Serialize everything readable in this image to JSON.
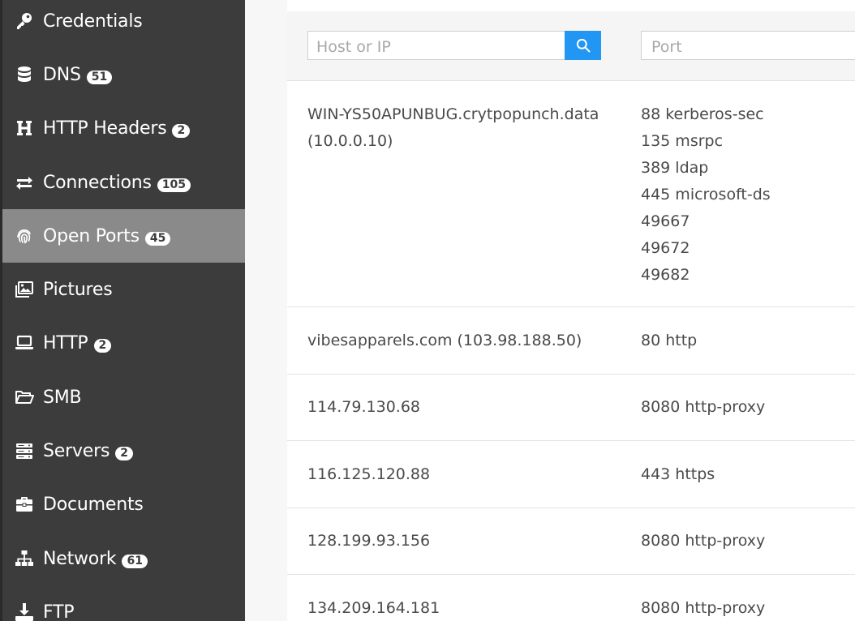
{
  "sidebar": {
    "items": [
      {
        "label": "Credentials",
        "badge": "",
        "icon": "key-icon",
        "active": false
      },
      {
        "label": "DNS",
        "badge": "51",
        "icon": "database-icon",
        "active": false
      },
      {
        "label": "HTTP Headers",
        "badge": "2",
        "icon": "header-icon",
        "active": false
      },
      {
        "label": "Connections",
        "badge": "105",
        "icon": "exchange-icon",
        "active": false
      },
      {
        "label": "Open Ports",
        "badge": "45",
        "icon": "fingerprint-icon",
        "active": true
      },
      {
        "label": "Pictures",
        "badge": "",
        "icon": "images-icon",
        "active": false
      },
      {
        "label": "HTTP",
        "badge": "2",
        "icon": "laptop-icon",
        "active": false
      },
      {
        "label": "SMB",
        "badge": "",
        "icon": "folder-open-icon",
        "active": false
      },
      {
        "label": "Servers",
        "badge": "2",
        "icon": "server-icon",
        "active": false
      },
      {
        "label": "Documents",
        "badge": "",
        "icon": "briefcase-icon",
        "active": false
      },
      {
        "label": "Network",
        "badge": "61",
        "icon": "sitemap-icon",
        "active": false
      },
      {
        "label": "FTP",
        "badge": "",
        "icon": "download-icon",
        "active": false
      }
    ]
  },
  "filters": {
    "host_placeholder": "Host or IP",
    "host_value": "",
    "port_placeholder": "Port",
    "port_value": "",
    "search_icon": "search-icon",
    "accent_color": "#2196f3"
  },
  "table": {
    "rows": [
      {
        "host": [
          "WIN-YS50APUNBUG.crytpopunch.data",
          "(10.0.0.10)"
        ],
        "ports": [
          "88 kerberos-sec",
          "135 msrpc",
          "389 ldap",
          "445 microsoft-ds",
          "49667",
          "49672",
          "49682"
        ]
      },
      {
        "host": [
          "vibesapparels.com (103.98.188.50)"
        ],
        "ports": [
          "80 http"
        ]
      },
      {
        "host": [
          "114.79.130.68"
        ],
        "ports": [
          "8080 http-proxy"
        ]
      },
      {
        "host": [
          "116.125.120.88"
        ],
        "ports": [
          "443 https"
        ]
      },
      {
        "host": [
          "128.199.93.156"
        ],
        "ports": [
          "8080 http-proxy"
        ]
      },
      {
        "host": [
          "134.209.164.181"
        ],
        "ports": [
          "8080 http-proxy"
        ]
      }
    ]
  },
  "colors": {
    "sidebar_bg": "#3c3c3c",
    "sidebar_active": "#8a8a8a",
    "text": "#4a4a4a"
  }
}
